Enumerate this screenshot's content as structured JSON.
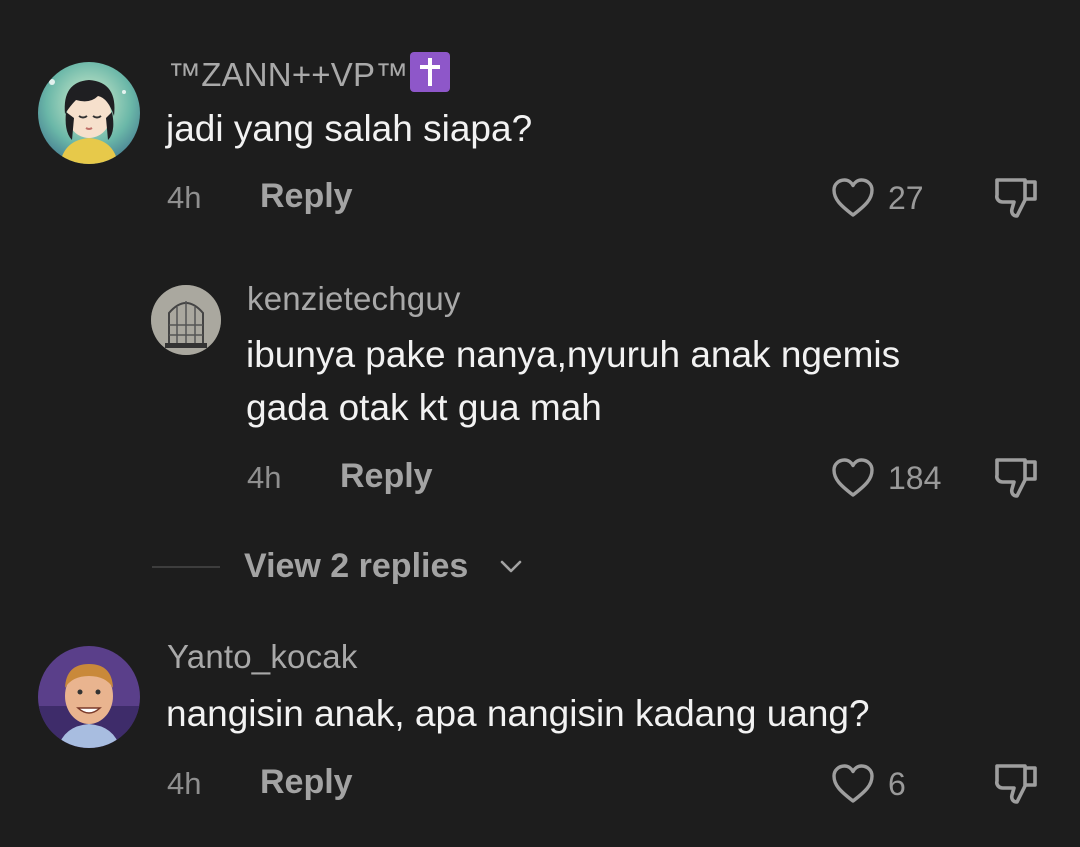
{
  "comments": [
    {
      "username": "™ZANN++VP™",
      "text": "jadi yang salah siapa?",
      "time": "4h",
      "reply_label": "Reply",
      "like_count": "27"
    },
    {
      "username": "kenzietechguy",
      "text": "ibunya pake nanya,nyuruh anak ngemis\ngada otak kt gua mah",
      "time": "4h",
      "reply_label": "Reply",
      "like_count": "184"
    },
    {
      "username": "Yanto_kocak",
      "text": "nangisin anak, apa nangisin kadang uang?",
      "time": "4h",
      "reply_label": "Reply",
      "like_count": "6"
    }
  ],
  "view_replies": {
    "label": "View 2 replies"
  },
  "colors": {
    "background": "#1d1d1d",
    "primary_text": "#f2f2f2",
    "secondary_text": "#a9a9a9",
    "badge": "#8e57c9"
  },
  "icons": {
    "like": "heart-outline-icon",
    "dislike": "thumbs-down-icon",
    "badge": "latin-cross-icon",
    "expand": "chevron-down-icon"
  }
}
